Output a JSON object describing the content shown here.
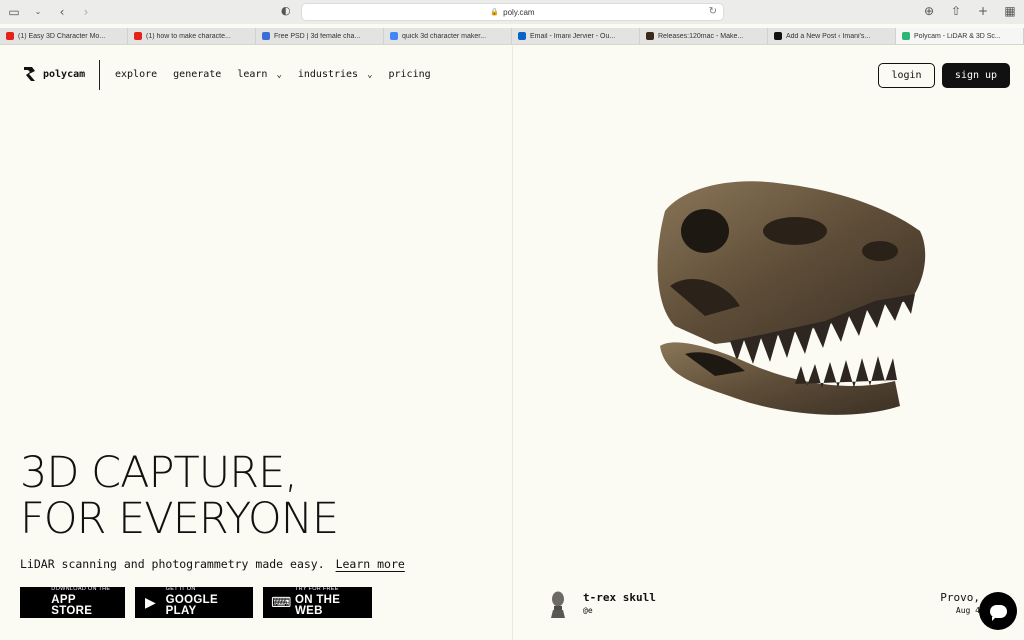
{
  "browser": {
    "url": "poly.cam",
    "tabs": [
      {
        "label": "(1) Easy 3D Character Mo...",
        "favicon_color": "#e62117"
      },
      {
        "label": "(1) how to make characte...",
        "favicon_color": "#e62117"
      },
      {
        "label": "Free PSD | 3d female cha...",
        "favicon_color": "#3a6fd8"
      },
      {
        "label": "quick 3d character maker...",
        "favicon_color": "#4285f4"
      },
      {
        "label": "Email - Imani Jervier - Ou...",
        "favicon_color": "#0a64c8"
      },
      {
        "label": "Releases:120mac - Make...",
        "favicon_color": "#3b2a1a"
      },
      {
        "label": "Add a New Post ‹ Imani's...",
        "favicon_color": "#111111"
      },
      {
        "label": "Polycam - LiDAR & 3D Sc...",
        "favicon_color": "#2bb673",
        "active": true
      }
    ]
  },
  "header": {
    "brand": "polycam",
    "nav": [
      {
        "label": "explore",
        "dropdown": false
      },
      {
        "label": "generate",
        "dropdown": false
      },
      {
        "label": "learn",
        "dropdown": true
      },
      {
        "label": "industries",
        "dropdown": true
      },
      {
        "label": "pricing",
        "dropdown": false
      }
    ],
    "login_label": "login",
    "signup_label": "sign up"
  },
  "hero": {
    "title_line1": "3D CAPTURE,",
    "title_line2": "FOR EVERYONE",
    "tagline": "LiDAR scanning and photogrammetry made easy.",
    "learn_more": "Learn more",
    "badges": [
      {
        "small": "DOWNLOAD ON THE",
        "big": "APP STORE",
        "icon": "apple-icon"
      },
      {
        "small": "GET IT ON",
        "big": "GOOGLE PLAY",
        "icon": "google-play-icon"
      },
      {
        "small": "TRY FOR FREE",
        "big": "ON THE WEB",
        "icon": "laptop-icon"
      }
    ]
  },
  "showcase": {
    "model_name": "t-rex skull",
    "creator": "@e",
    "location": "Provo,",
    "date": "Aug 4"
  },
  "colors": {
    "page_bg": "#fbfbf3",
    "ink": "#111111"
  }
}
